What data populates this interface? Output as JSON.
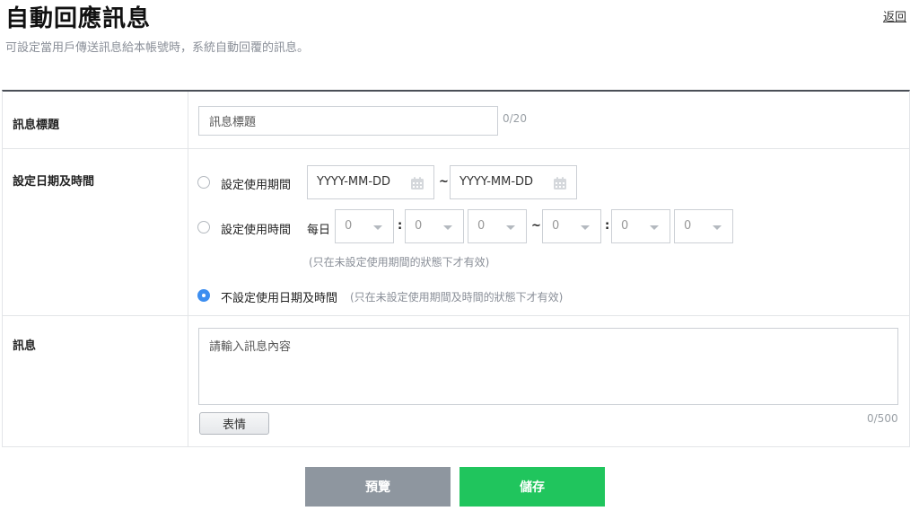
{
  "header": {
    "title": "自動回應訊息",
    "back_label": "返回",
    "subtitle": "可設定當用戶傳送訊息給本帳號時，系統自動回覆的訊息。"
  },
  "form": {
    "title_row": {
      "label": "訊息標題",
      "input_placeholder": "訊息標題",
      "counter": "0/20"
    },
    "datetime_row": {
      "label": "設定日期及時間",
      "option_period": {
        "label": "設定使用期間",
        "start_placeholder": "YYYY-MM-DD",
        "end_placeholder": "YYYY-MM-DD",
        "separator": "~",
        "checked": false
      },
      "option_time": {
        "label": "設定使用時間",
        "daily_label": "每日",
        "selects": [
          "0",
          "0",
          "0",
          "0",
          "0",
          "0"
        ],
        "colon": ":",
        "separator": "~",
        "hint": "(只在未設定使用期間的狀態下才有效)",
        "checked": false
      },
      "option_none": {
        "label": "不設定使用日期及時間",
        "hint": "(只在未設定使用期間及時間的狀態下才有效)",
        "checked": true
      }
    },
    "message_row": {
      "label": "訊息",
      "placeholder": "請輸入訊息內容",
      "counter": "0/500",
      "emoji_button": "表情"
    }
  },
  "actions": {
    "preview_label": "預覽",
    "save_label": "儲存"
  },
  "colors": {
    "save": "#20c55d",
    "preview": "#8e969f",
    "radio_checked": "#3d8ef0"
  }
}
